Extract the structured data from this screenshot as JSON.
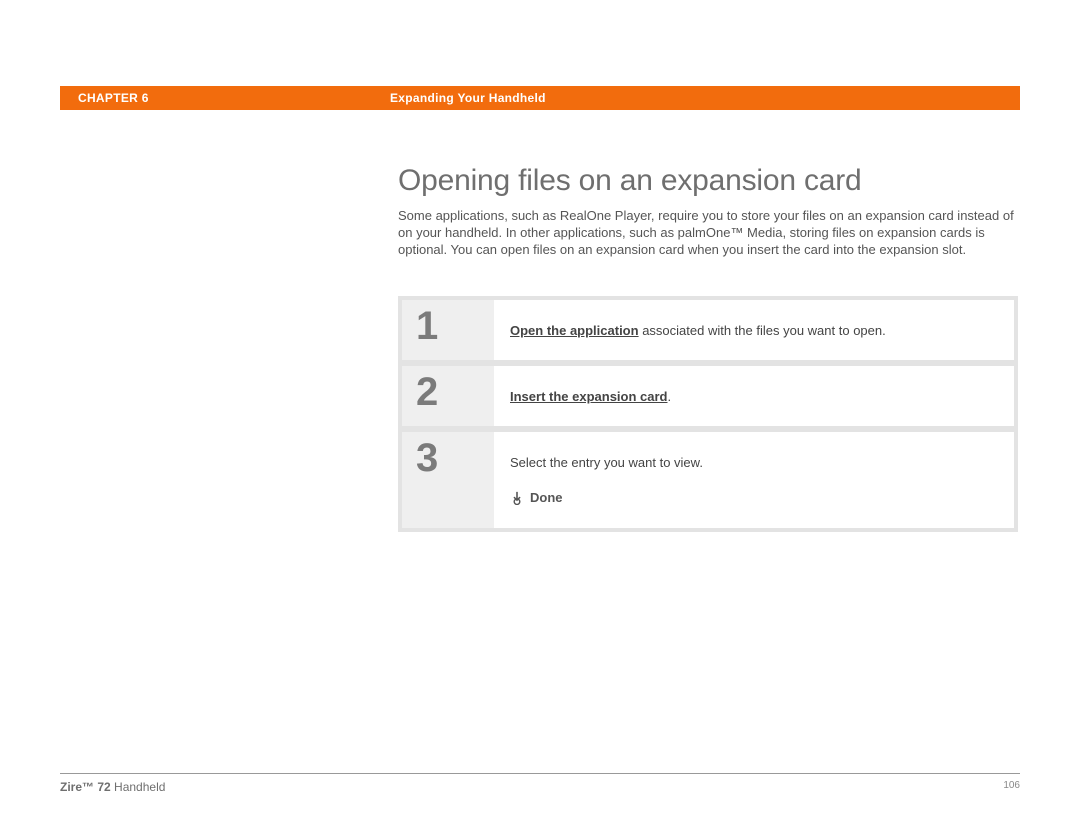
{
  "header": {
    "chapter": "CHAPTER 6",
    "section": "Expanding Your Handheld"
  },
  "title": "Opening files on an expansion card",
  "intro": "Some applications, such as RealOne Player, require you to store your files on an expansion card instead of on your handheld. In other applications, such as palmOne™ Media, storing files on expansion cards is optional. You can open files on an expansion card when you insert the card into the expansion slot.",
  "steps": {
    "s1": {
      "num": "1",
      "link": "Open the application",
      "rest": " associated with the files you want to open."
    },
    "s2": {
      "num": "2",
      "link": "Insert the expansion card",
      "dot": "."
    },
    "s3": {
      "num": "3",
      "text": "Select the entry you want to view.",
      "done": "Done"
    }
  },
  "footer": {
    "product_bold": "Zire™ 72",
    "product_rest": " Handheld",
    "page": "106"
  }
}
